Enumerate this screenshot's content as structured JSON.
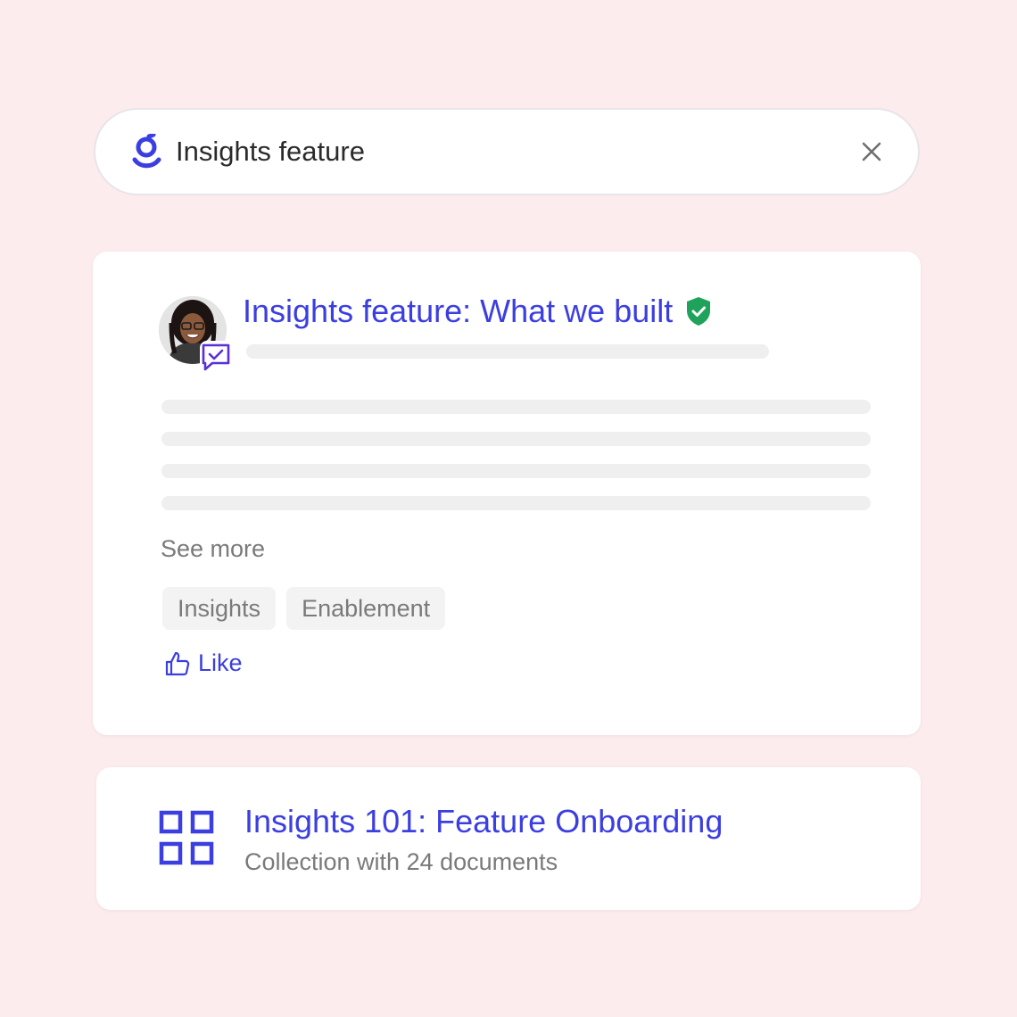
{
  "search": {
    "value": "Insights feature",
    "logo_icon": "glean-logo-icon",
    "clear_icon": "close-icon"
  },
  "result_card": {
    "title": "Insights feature: What we built",
    "verified_icon": "verified-shield-icon",
    "badge_icon": "chat-check-icon",
    "see_more": "See more",
    "tags": [
      "Insights",
      "Enablement"
    ],
    "like_label": "Like",
    "like_icon": "thumbs-up-icon"
  },
  "collection_card": {
    "icon": "grid-icon",
    "title": "Insights 101: Feature Onboarding",
    "subtitle": "Collection with 24 documents"
  },
  "colors": {
    "background": "#fdeced",
    "accent": "#3b3ee0",
    "verified": "#1fa35b",
    "muted_text": "#7a7a7a",
    "skeleton": "#efefef"
  }
}
